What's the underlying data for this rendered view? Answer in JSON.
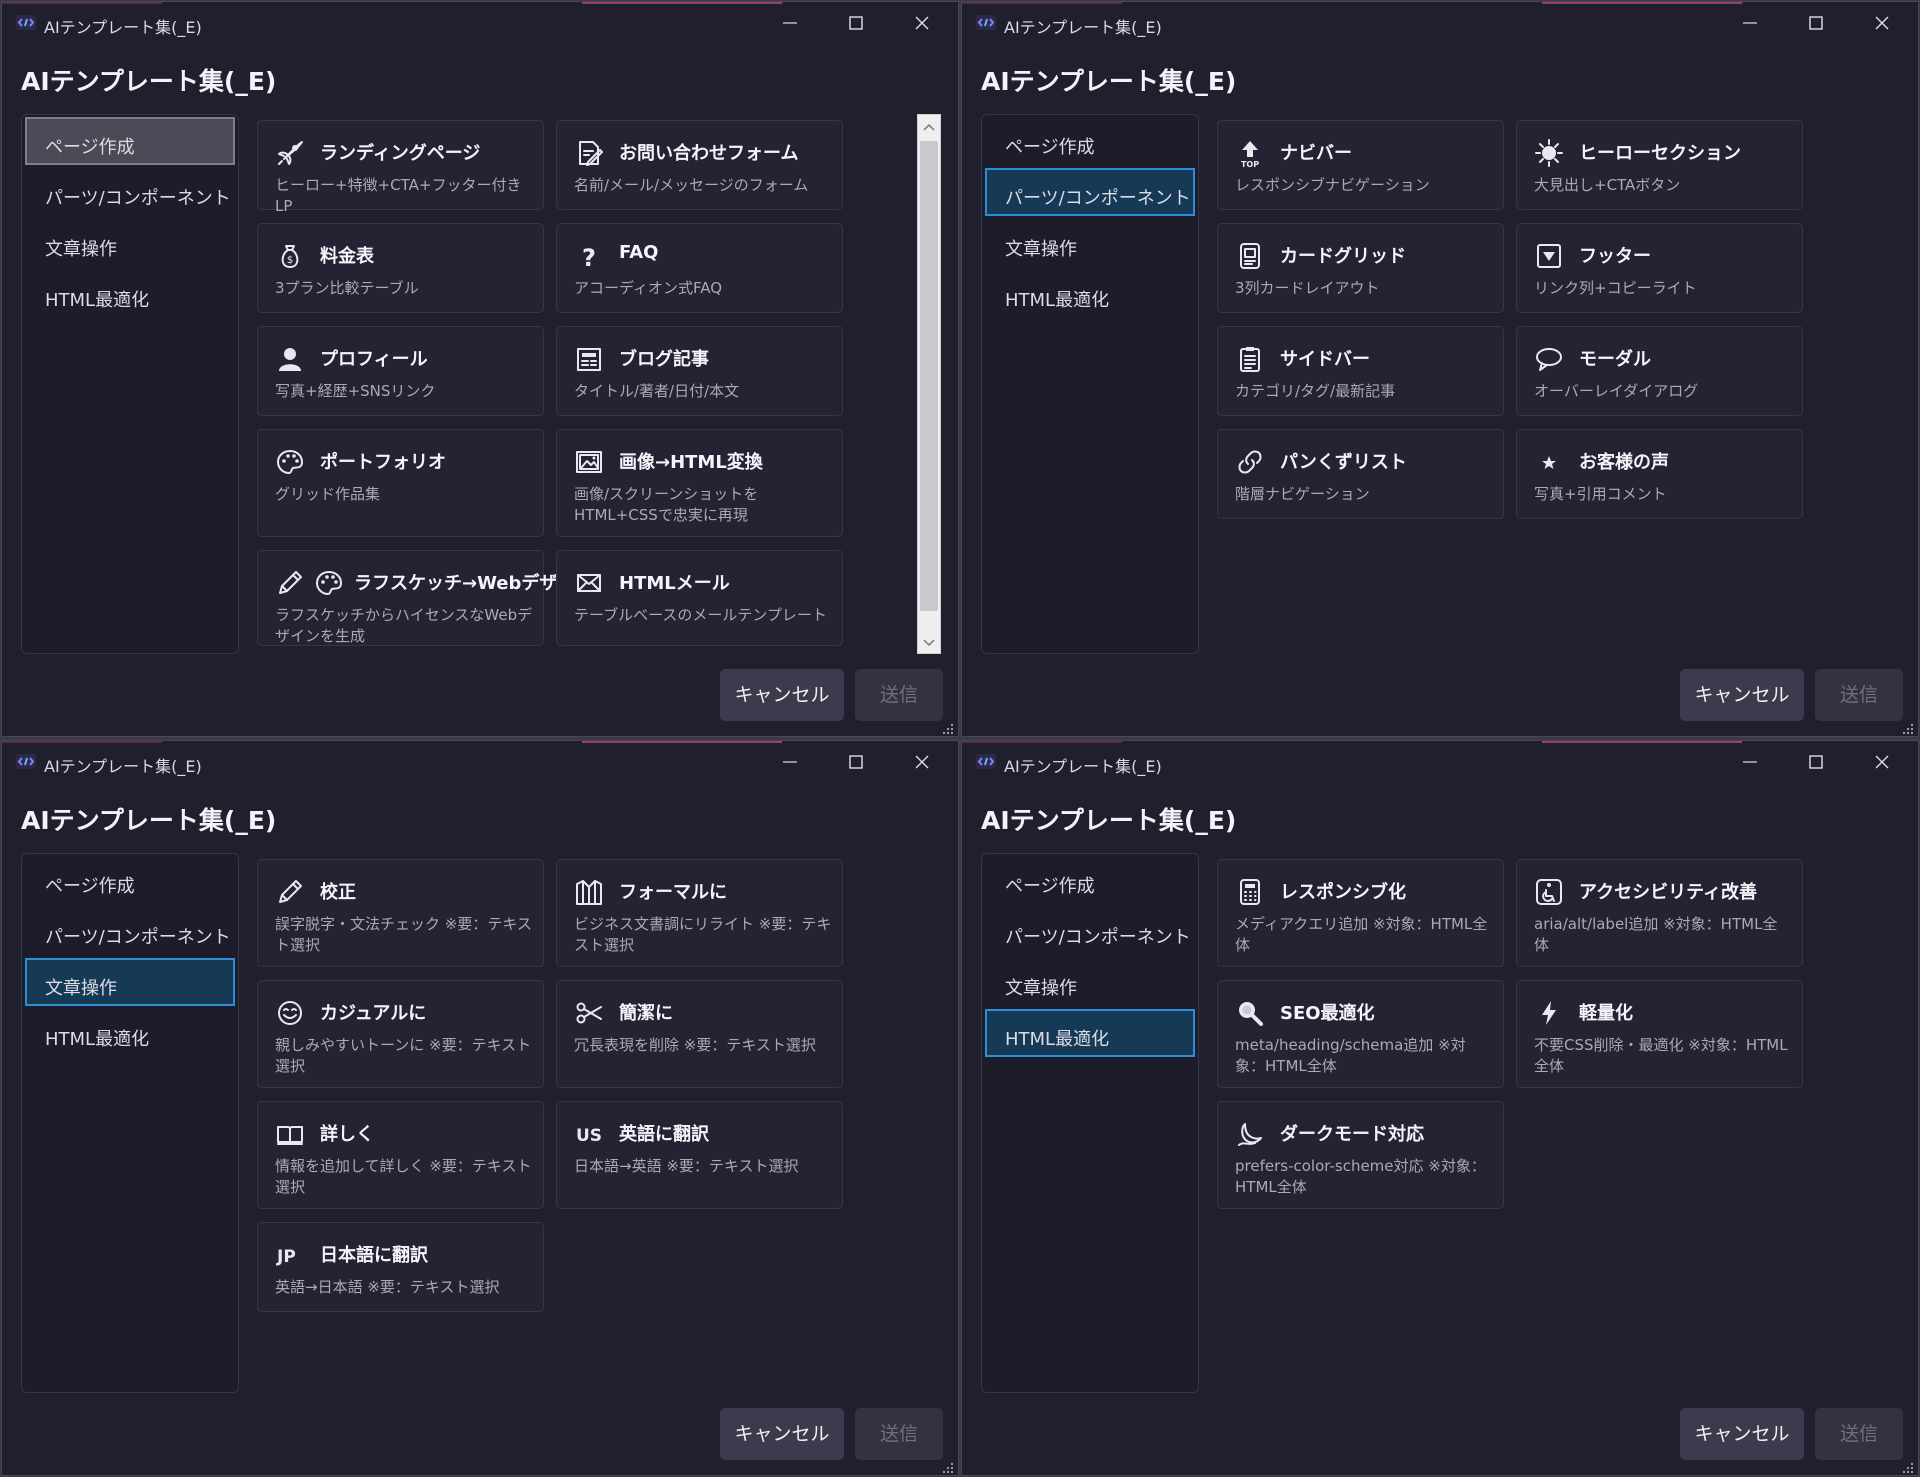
{
  "window_title": "AIテンプレート集(_E)",
  "dialog_title": "AIテンプレート集(_E)",
  "nav": [
    "ページ作成",
    "パーツ/コンポーネント",
    "文章操作",
    "HTML最適化"
  ],
  "buttons": {
    "cancel": "キャンセル",
    "send": "送信"
  },
  "panels": [
    {
      "selected": 0,
      "cards": [
        {
          "icon": "rocket-icon",
          "title": "ランディングページ",
          "desc": "ヒーロー+特徴+CTA+フッター付きLP"
        },
        {
          "icon": "form-edit-icon",
          "title": "お問い合わせフォーム",
          "desc": "名前/メール/メッセージのフォーム"
        },
        {
          "icon": "money-bag-icon",
          "title": "料金表",
          "desc": "3プラン比較テーブル"
        },
        {
          "icon": "question-icon",
          "title": "FAQ",
          "desc": "アコーディオン式FAQ"
        },
        {
          "icon": "person-icon",
          "title": "プロフィール",
          "desc": "写真+経歴+SNSリンク"
        },
        {
          "icon": "newspaper-icon",
          "title": "ブログ記事",
          "desc": "タイトル/著者/日付/本文"
        },
        {
          "icon": "palette-icon",
          "title": "ポートフォリオ",
          "desc": "グリッド作品集"
        },
        {
          "icon": "image-frame-icon",
          "title": "画像→HTML変換",
          "desc": "画像/スクリーンショットをHTML+CSSで忠実に再現"
        },
        {
          "icon": "pencil-icon",
          "icon2": "palette-icon",
          "title": "ラフスケッチ→Webデザ",
          "desc": "ラフスケッチからハイセンスなWebデザインを生成"
        },
        {
          "icon": "mail-icon",
          "title": "HTMLメール",
          "desc": "テーブルベースのメールテンプレート"
        }
      ]
    },
    {
      "selected": 1,
      "cards": [
        {
          "icon": "top-arrow-icon",
          "title": "ナビバー",
          "desc": "レスポンシブナビゲーション"
        },
        {
          "icon": "sun-icon",
          "title": "ヒーローセクション",
          "desc": "大見出し+CTAボタン"
        },
        {
          "icon": "card-grid-icon",
          "title": "カードグリッド",
          "desc": "3列カードレイアウト"
        },
        {
          "icon": "down-box-icon",
          "title": "フッター",
          "desc": "リンク列+コピーライト"
        },
        {
          "icon": "clipboard-icon",
          "title": "サイドバー",
          "desc": "カテゴリ/タグ/最新記事"
        },
        {
          "icon": "speech-bubble-icon",
          "title": "モーダル",
          "desc": "オーバーレイダイアログ"
        },
        {
          "icon": "link-icon",
          "title": "パンくずリスト",
          "desc": "階層ナビゲーション"
        },
        {
          "icon": "star-icon",
          "title": "お客様の声",
          "desc": "写真+引用コメント"
        }
      ]
    },
    {
      "selected": 2,
      "cards": [
        {
          "icon": "pencil-icon",
          "title": "校正",
          "desc": "誤字脱字・文法チェック ※要：テキスト選択"
        },
        {
          "icon": "suit-icon",
          "title": "フォーマルに",
          "desc": "ビジネス文書調にリライト ※要：テキスト選択"
        },
        {
          "icon": "smile-icon",
          "title": "カジュアルに",
          "desc": "親しみやすいトーンに ※要：テキスト選択"
        },
        {
          "icon": "scissors-icon",
          "title": "簡潔に",
          "desc": "冗長表現を削除 ※要：テキスト選択"
        },
        {
          "icon": "book-icon",
          "title": "詳しく",
          "desc": "情報を追加して詳しく ※要：テキスト選択"
        },
        {
          "icon": "us-icon",
          "icon_text": "US",
          "title": "英語に翻訳",
          "desc": "日本語→英語 ※要：テキスト選択"
        },
        {
          "icon": "jp-icon",
          "icon_text": "JP",
          "title": "日本語に翻訳",
          "desc": "英語→日本語 ※要：テキスト選択"
        }
      ]
    },
    {
      "selected": 3,
      "cards": [
        {
          "icon": "calculator-icon",
          "title": "レスポンシブ化",
          "desc": "メディアクエリ追加 ※対象：HTML全体"
        },
        {
          "icon": "accessibility-icon",
          "title": "アクセシビリティ改善",
          "desc": "aria/alt/label追加 ※対象：HTML全体"
        },
        {
          "icon": "magnifier-icon",
          "title": "SEO最適化",
          "desc": "meta/heading/schema追加 ※対象：HTML全体"
        },
        {
          "icon": "lightning-icon",
          "title": "軽量化",
          "desc": "不要CSS削除・最適化 ※対象：HTML全体"
        },
        {
          "icon": "moon-icon",
          "title": "ダークモード対応",
          "desc": "prefers-color-scheme対応 ※対象：HTML全体"
        }
      ]
    }
  ],
  "colors": {
    "window_bg": "#1f1f2e",
    "card_bg": "#232334",
    "selected_blue": "#163a55",
    "selected_blue_border": "#2f8dd6",
    "selected_gray": "#4b4b58"
  }
}
